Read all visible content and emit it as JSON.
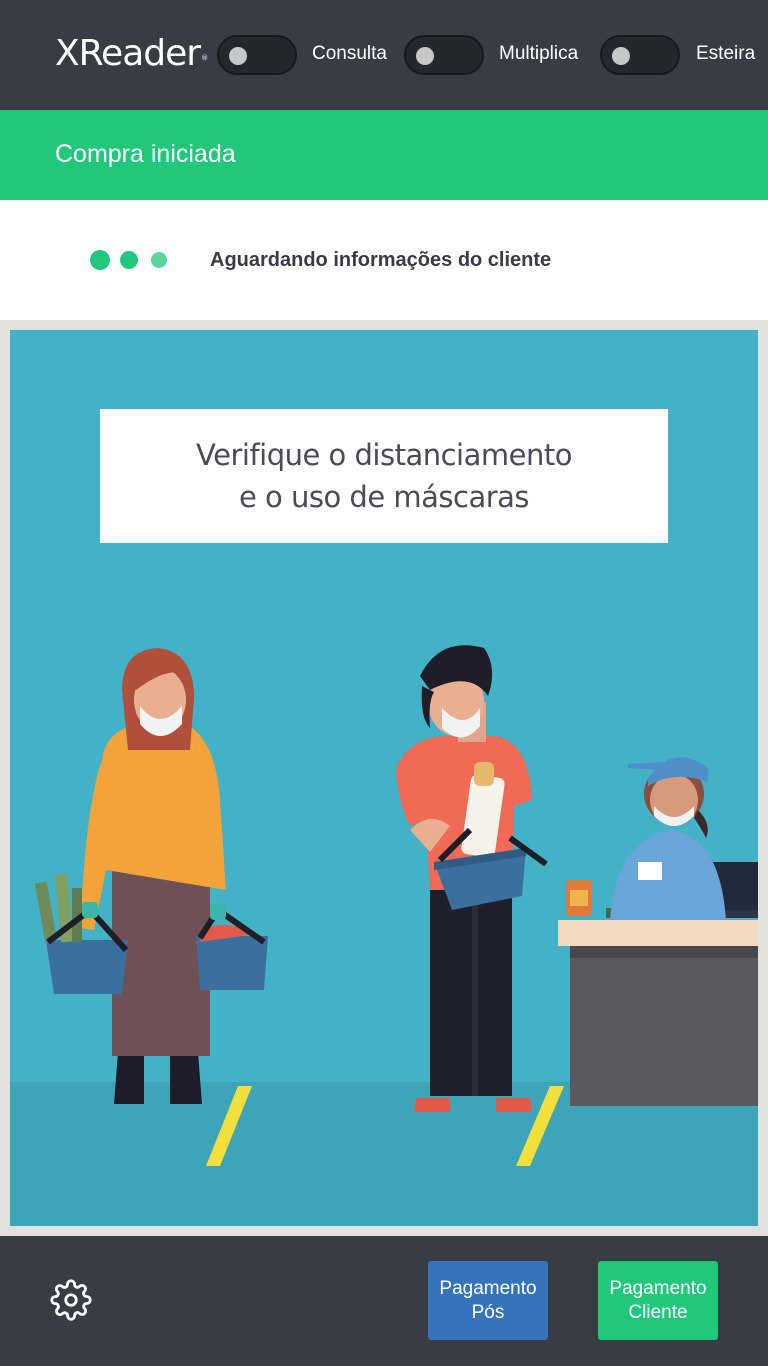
{
  "header": {
    "app_name": "XReader",
    "registered_mark": "®",
    "toggles": [
      {
        "label": "Consulta",
        "on": false
      },
      {
        "label": "Multiplica",
        "on": false
      },
      {
        "label": "Esteira",
        "on": false
      }
    ]
  },
  "status": {
    "title": "Compra iniciada"
  },
  "waiting": {
    "message": "Aguardando informações do cliente",
    "loader_icon": "three-dots-loader-icon"
  },
  "illustration": {
    "notice_line1": "Verifique o distanciamento",
    "notice_line2": "e o uso de máscaras"
  },
  "footer": {
    "settings_icon": "gear-icon",
    "buttons": [
      {
        "line1": "Pagamento",
        "line2": "Pós",
        "color": "#3574bb"
      },
      {
        "line1": "Pagamento",
        "line2": "Cliente",
        "color": "#21c77b"
      }
    ]
  },
  "colors": {
    "brand_green": "#21c77b",
    "header_dark": "#383c43",
    "accent_blue": "#3574bb"
  }
}
